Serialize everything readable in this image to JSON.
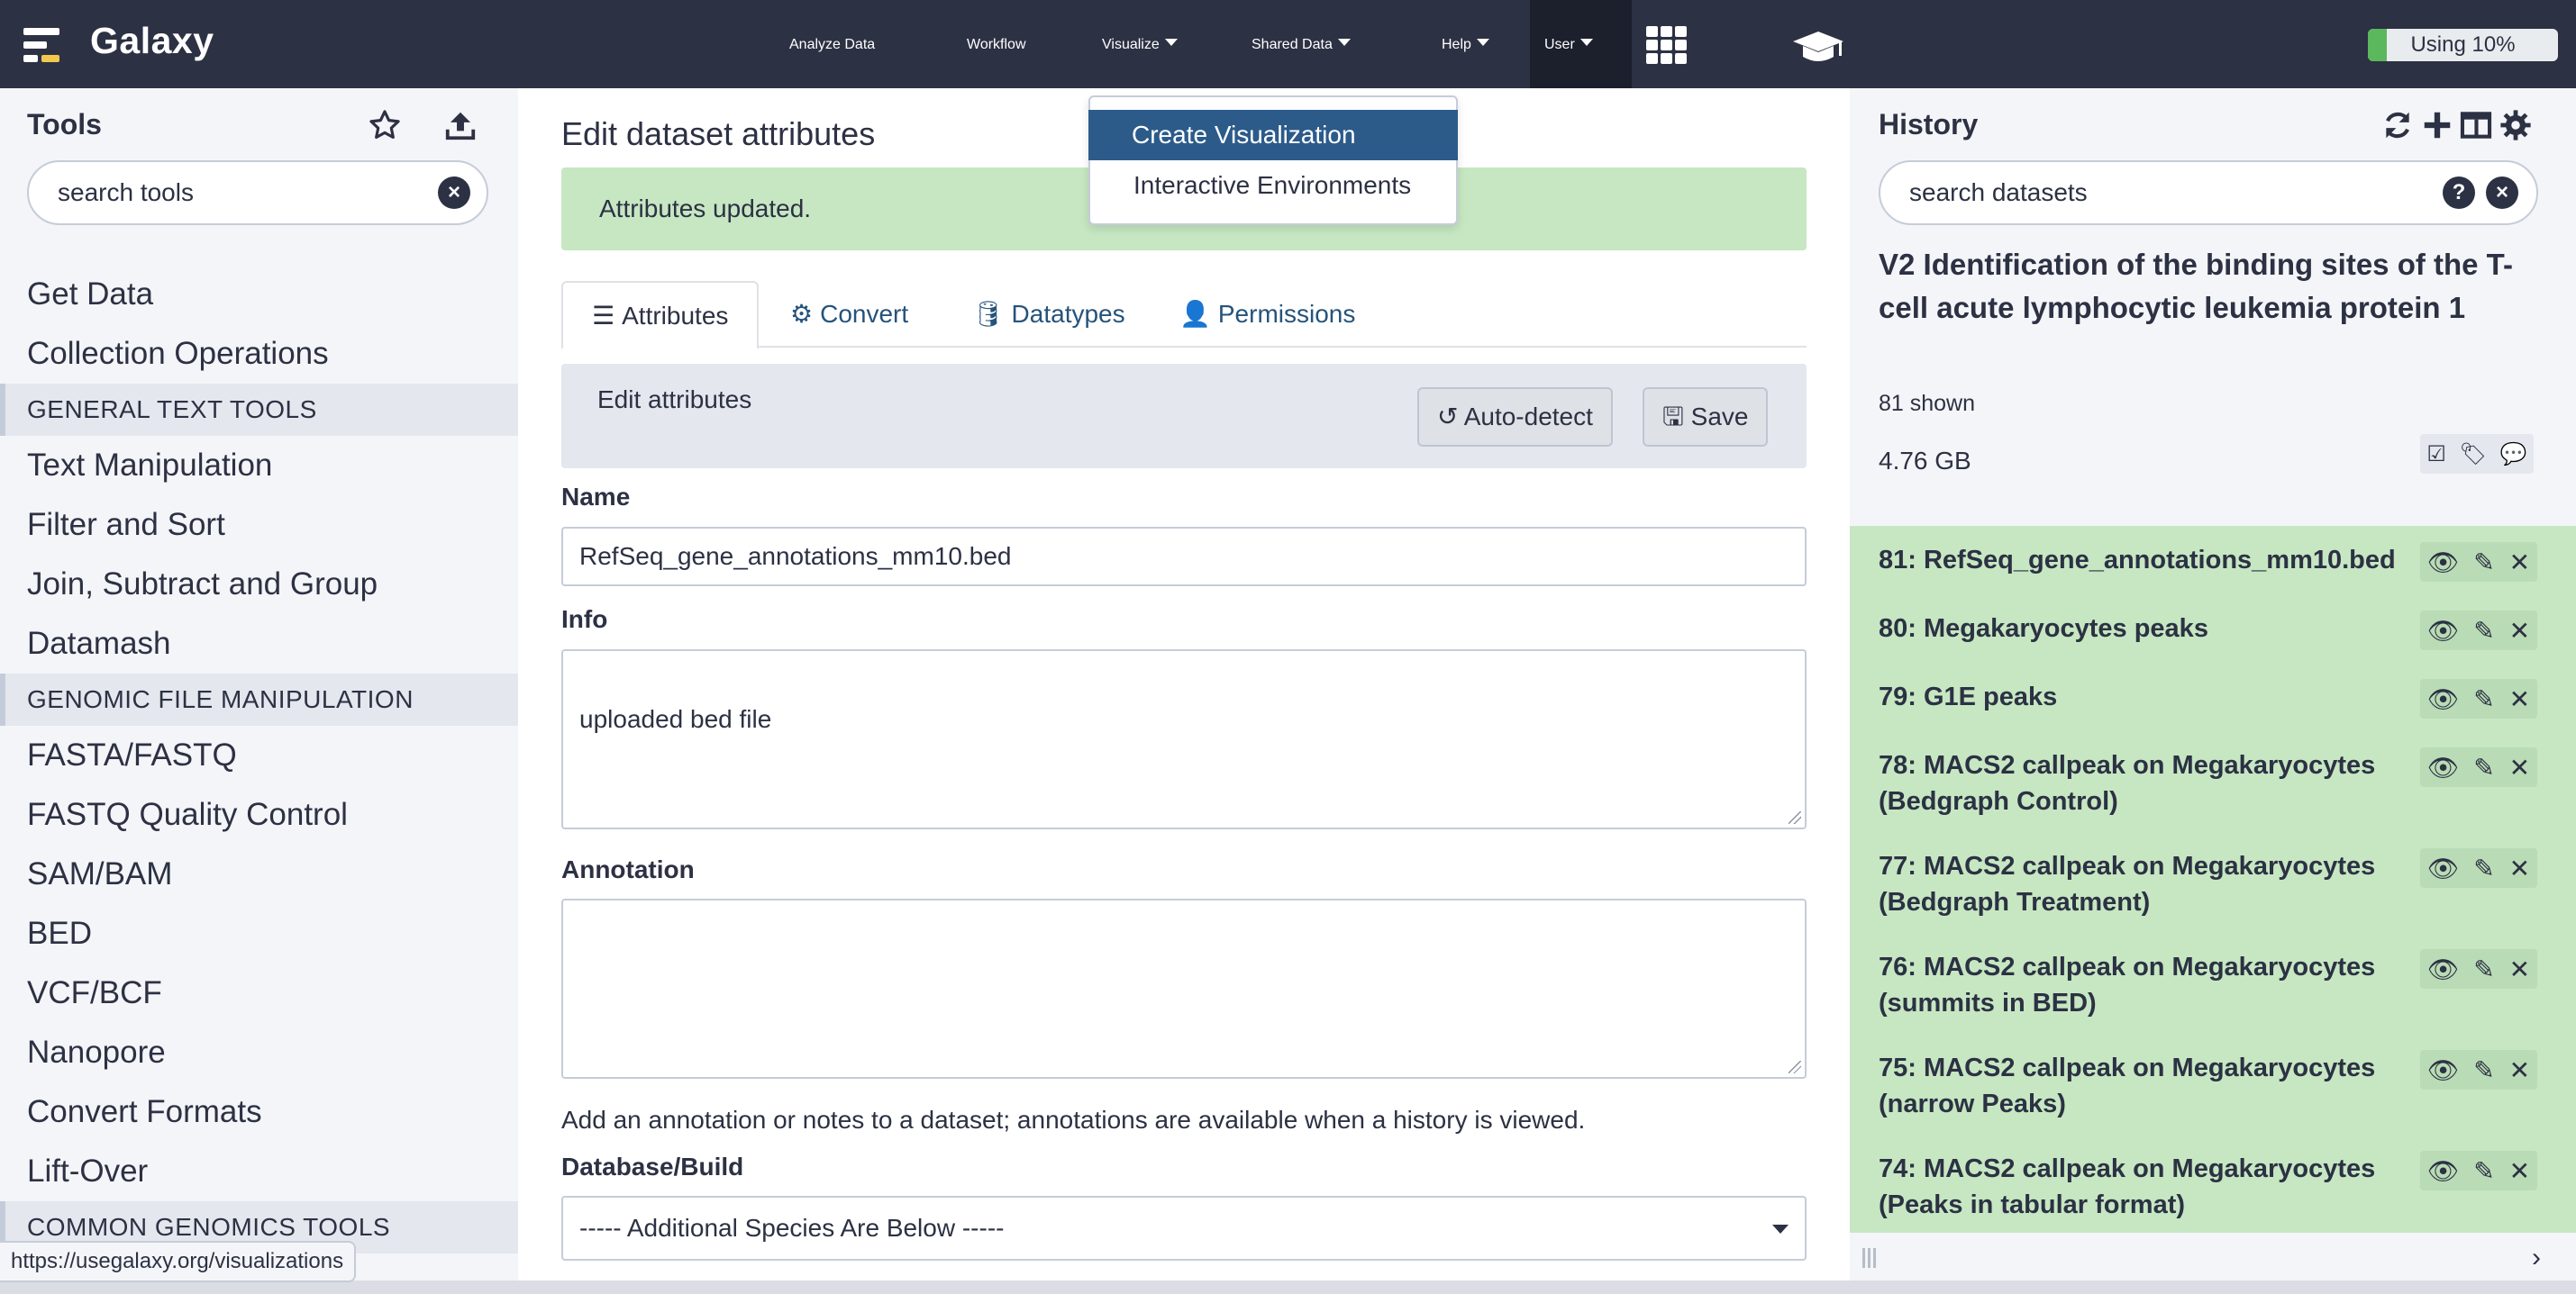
{
  "masthead": {
    "brand": "Galaxy",
    "nav": {
      "analyze": "Analyze Data",
      "workflow": "Workflow",
      "visualize": "Visualize",
      "shared": "Shared Data",
      "help": "Help",
      "user": "User"
    },
    "quota_label": "Using 10%",
    "quota_percent": 10,
    "quota_color": "#5cb85c"
  },
  "visualize_menu": {
    "items": [
      "Create Visualization",
      "Interactive Environments"
    ]
  },
  "tools": {
    "title": "Tools",
    "search_placeholder": "search tools",
    "items": [
      {
        "type": "link",
        "label": "Get Data"
      },
      {
        "type": "link",
        "label": "Collection Operations"
      },
      {
        "type": "section",
        "label": "GENERAL TEXT TOOLS"
      },
      {
        "type": "link",
        "label": "Text Manipulation"
      },
      {
        "type": "link",
        "label": "Filter and Sort"
      },
      {
        "type": "link",
        "label": "Join, Subtract and Group"
      },
      {
        "type": "link",
        "label": "Datamash"
      },
      {
        "type": "section",
        "label": "GENOMIC FILE MANIPULATION"
      },
      {
        "type": "link",
        "label": "FASTA/FASTQ"
      },
      {
        "type": "link",
        "label": "FASTQ Quality Control"
      },
      {
        "type": "link",
        "label": "SAM/BAM"
      },
      {
        "type": "link",
        "label": "BED"
      },
      {
        "type": "link",
        "label": "VCF/BCF"
      },
      {
        "type": "link",
        "label": "Nanopore"
      },
      {
        "type": "link",
        "label": "Convert Formats"
      },
      {
        "type": "link",
        "label": "Lift-Over"
      },
      {
        "type": "section",
        "label": "COMMON GENOMICS TOOLS"
      }
    ]
  },
  "center": {
    "title": "Edit dataset attributes",
    "alert": "Attributes updated.",
    "tabs": {
      "attributes": "Attributes",
      "convert": "Convert",
      "datatypes": "Datatypes",
      "permissions": "Permissions"
    },
    "card_heading": "Edit attributes",
    "autodetect_label": "Auto-detect",
    "save_label": "Save",
    "name_label": "Name",
    "name_value": "RefSeq_gene_annotations_mm10.bed",
    "info_label": "Info",
    "info_value": "uploaded bed file",
    "annotation_label": "Annotation",
    "annotation_value": "",
    "annotation_help": "Add an annotation or notes to a dataset; annotations are available when a history is viewed.",
    "dbkey_label": "Database/Build",
    "dbkey_value": "----- Additional Species Are Below -----"
  },
  "history": {
    "title": "History",
    "search_placeholder": "search datasets",
    "name": "V2 Identification of the binding sites of the T-cell acute lymphocytic leukemia protein 1",
    "shown": "81 shown",
    "size": "4.76 GB",
    "datasets": [
      {
        "title": "81: RefSeq_gene_annotations_mm10.bed"
      },
      {
        "title": "80: Megakaryocytes peaks"
      },
      {
        "title": "79: G1E peaks"
      },
      {
        "title": "78: MACS2 callpeak on Megakaryocytes (Bedgraph Control)"
      },
      {
        "title": "77: MACS2 callpeak on Megakaryocytes (Bedgraph Treatment)"
      },
      {
        "title": "76: MACS2 callpeak on Megakaryocytes (summits in BED)"
      },
      {
        "title": "75: MACS2 callpeak on Megakaryocytes (narrow Peaks)"
      },
      {
        "title": "74: MACS2 callpeak on Megakaryocytes (Peaks in tabular format)"
      }
    ]
  },
  "status_url": "https://usegalaxy.org/visualizations",
  "icons": {
    "menu": "galaxy-logo-icon",
    "apps": "grid-icon",
    "training": "graduation-cap-icon",
    "favorite": "star-icon",
    "upload": "upload-icon",
    "refresh": "refresh-icon",
    "new_history": "plus-icon",
    "multiview": "columns-icon",
    "options": "gear-icon"
  }
}
